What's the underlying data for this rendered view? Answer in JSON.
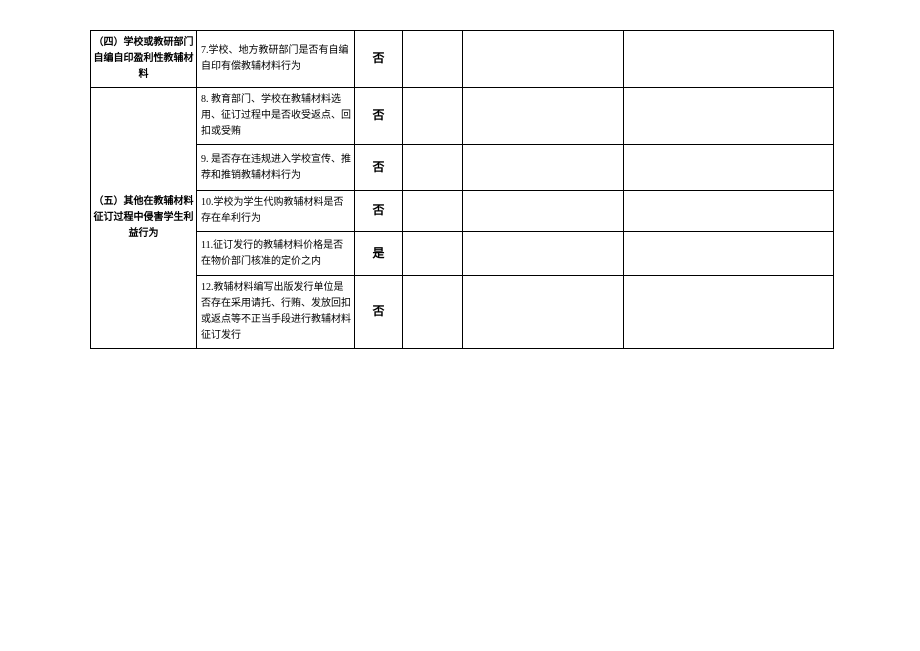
{
  "categories": {
    "cat4": "（四）学校或教研部门自编自印盈利性教辅材料",
    "cat5": "（五）其他在教辅材料征订过程中侵害学生利益行为"
  },
  "items": {
    "i7": "7.学校、地方教研部门是否有自编自印有偿教辅材料行为",
    "i8": "8. 教育部门、学校在教辅材料选用、征订过程中是否收受返点、回扣或受贿",
    "i9": "9. 是否存在违规进入学校宣传、推荐和推销教辅材料行为",
    "i10": "10.学校为学生代购教辅材料是否存在牟利行为",
    "i11": "11.征订发行的教辅材料价格是否在物价部门核准的定价之内",
    "i12": "12.教辅材料编写出版发行单位是否存在采用请托、行贿、发放回扣或返点等不正当手段进行教辅材料征订发行"
  },
  "answers": {
    "a7": "否",
    "a8": "否",
    "a9": "否",
    "a10": "否",
    "a11": "是",
    "a12": "否"
  }
}
